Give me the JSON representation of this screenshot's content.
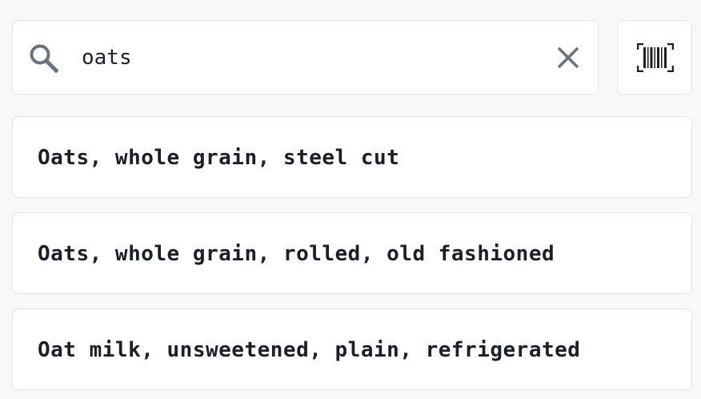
{
  "search": {
    "query": "oats",
    "search_icon": "search-icon",
    "clear_icon": "close-icon"
  },
  "scan": {
    "icon": "barcode-scan-icon"
  },
  "results": [
    {
      "label": "Oats, whole grain, steel cut"
    },
    {
      "label": "Oats, whole grain, rolled, old fashioned"
    },
    {
      "label": "Oat milk, unsweetened, plain, refrigerated"
    }
  ],
  "colors": {
    "background": "#f7f8fa",
    "card": "#ffffff",
    "border": "#e3e5ea",
    "text": "#1c1f2a",
    "icon": "#6a7280"
  }
}
